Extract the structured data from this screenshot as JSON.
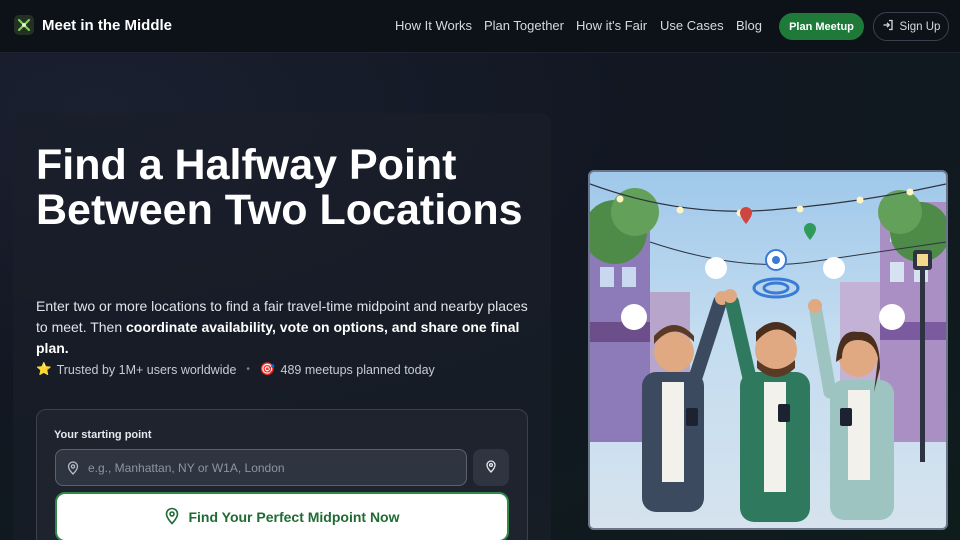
{
  "nav": {
    "brand": "Meet in the Middle",
    "links": [
      "How It Works",
      "Plan Together",
      "How it's Fair",
      "Use Cases",
      "Blog"
    ],
    "plan_button": "Plan Meetup",
    "signin_button": "Sign Up"
  },
  "hero": {
    "title": "Find a Halfway Point Between Two Locations",
    "desc_plain": "Enter two or more locations to find a fair travel-time midpoint and nearby places to meet. Then ",
    "desc_bold": "coordinate availability, vote on options, and share one final plan.",
    "stat1_icon": "⭐",
    "stat1": "Trusted by 1M+ users worldwide",
    "stat_separator": "•",
    "stat2_icon": "🎯",
    "stat2": "489 meetups planned today"
  },
  "form": {
    "label": "Your starting point",
    "placeholder": "e.g., Manhattan, NY or W1A, London",
    "value": "",
    "cta": "Find Your Perfect Midpoint Now"
  },
  "colors": {
    "accent_green": "#1f7a3a",
    "cta_text": "#1f6b34",
    "background": "#121722"
  }
}
